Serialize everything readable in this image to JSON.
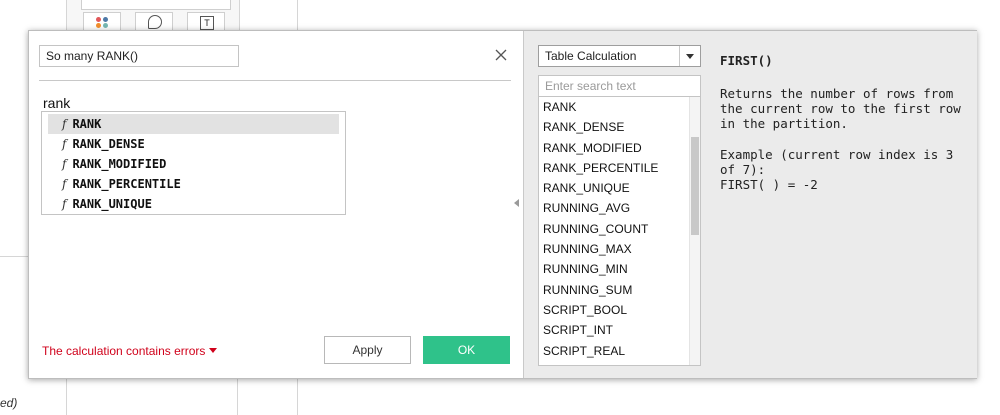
{
  "background": {
    "fragment_text": "ed)"
  },
  "dialog": {
    "calc_name": "So many RANK()",
    "formula": "rank",
    "autocomplete": [
      {
        "symbol": "f",
        "name": "RANK"
      },
      {
        "symbol": "f",
        "name": "RANK_DENSE"
      },
      {
        "symbol": "f",
        "name": "RANK_MODIFIED"
      },
      {
        "symbol": "f",
        "name": "RANK_PERCENTILE"
      },
      {
        "symbol": "f",
        "name": "RANK_UNIQUE"
      }
    ],
    "error_text": "The calculation contains errors",
    "apply_label": "Apply",
    "ok_label": "OK"
  },
  "reference": {
    "category": "Table Calculation",
    "search_placeholder": "Enter search text",
    "functions": [
      "RANK",
      "RANK_DENSE",
      "RANK_MODIFIED",
      "RANK_PERCENTILE",
      "RANK_UNIQUE",
      "RUNNING_AVG",
      "RUNNING_COUNT",
      "RUNNING_MAX",
      "RUNNING_MIN",
      "RUNNING_SUM",
      "SCRIPT_BOOL",
      "SCRIPT_INT",
      "SCRIPT_REAL"
    ],
    "help_title": "FIRST()",
    "help_desc": "Returns the number of rows from the current row to the first row in the partition.",
    "help_example_1": "Example (current row index is 3 of 7):",
    "help_example_2": "FIRST( ) = -2"
  },
  "colors": {
    "ok_button": "#2fc28a",
    "error_text": "#d0021b"
  }
}
